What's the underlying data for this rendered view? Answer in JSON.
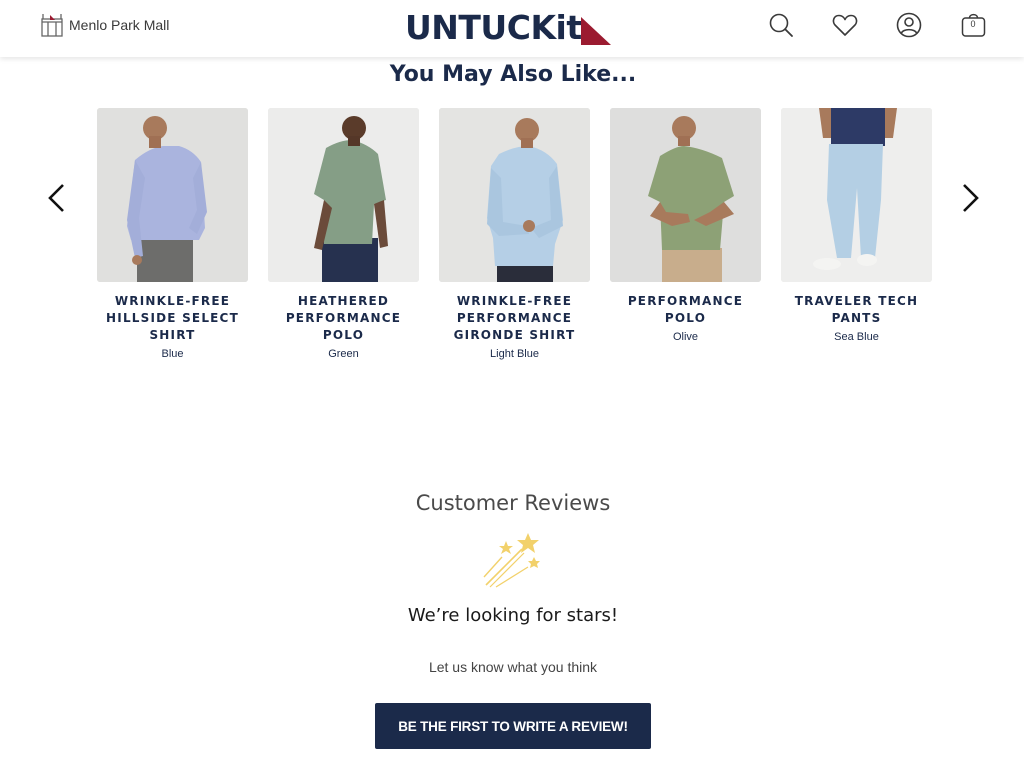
{
  "header": {
    "store_name": "Menlo Park Mall",
    "logo_text": "UNTUCKit",
    "icons": [
      "search-icon",
      "heart-icon",
      "account-icon",
      "bag-icon"
    ],
    "bag_count": "0"
  },
  "recommendations": {
    "title": "You May Also Like...",
    "products": [
      {
        "name": "Wrinkle-Free Hillside Select Shirt",
        "color": "Blue"
      },
      {
        "name": "Heathered Performance Polo",
        "color": "Green"
      },
      {
        "name": "Wrinkle-Free Performance Gironde Shirt",
        "color": "Light Blue"
      },
      {
        "name": "Performance Polo",
        "color": "Olive"
      },
      {
        "name": "Traveler Tech Pants",
        "color": "Sea Blue"
      }
    ]
  },
  "reviews": {
    "title": "Customer Reviews",
    "headline": "We’re looking for stars!",
    "subtext": "Let us know what you think",
    "cta_label": "BE THE FIRST TO WRITE A REVIEW!"
  },
  "colors": {
    "navy": "#1b2a4a",
    "brand_red": "#9b1b30",
    "star_gold": "#f2d16b"
  }
}
